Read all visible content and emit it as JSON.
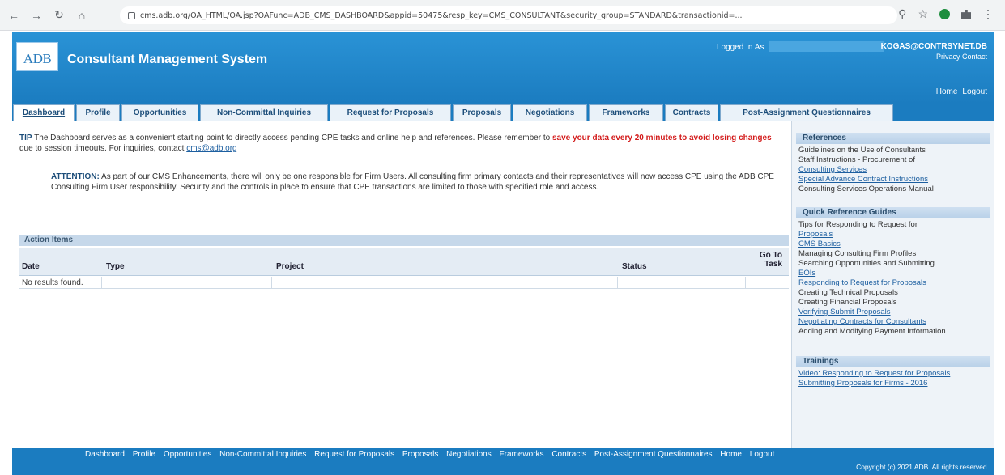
{
  "browser": {
    "url": "cms.adb.org/OA_HTML/OA.jsp?OAFunc=ADB_CMS_DASHBOARD&appid=50475&resp_key=CMS_CONSULTANT&security_group=STANDARD&transactionid=..."
  },
  "header": {
    "logo_text": "ADB",
    "app_title": "Consultant Management System",
    "logged_in_label": "Logged In As",
    "user": "KOGAS@CONTRSYNET.DB",
    "privacy": "Privacy Contact",
    "links": [
      "Home",
      "Logout"
    ]
  },
  "tabs": [
    {
      "label": "Dashboard",
      "active": true
    },
    {
      "label": "Profile",
      "active": false
    },
    {
      "label": "Opportunities",
      "active": false
    },
    {
      "label": "Non-Committal Inquiries",
      "active": false
    },
    {
      "label": "Request for Proposals",
      "active": false
    },
    {
      "label": "Proposals",
      "active": false
    },
    {
      "label": "Negotiations",
      "active": false
    },
    {
      "label": "Frameworks",
      "active": false
    },
    {
      "label": "Contracts",
      "active": false
    },
    {
      "label": "Post-Assignment Questionnaires",
      "active": false
    }
  ],
  "tip": {
    "label": "TIP",
    "text1": "The Dashboard serves as a convenient starting point to directly access pending CPE tasks and online help and references. Please remember to",
    "red": "save your data every 20 minutes to avoid losing changes",
    "text2": "due to session timeouts. For inquiries, contact",
    "link": "cms@adb.org"
  },
  "attention": {
    "label": "ATTENTION:",
    "text": "As part of our CMS Enhancements, there will only be one responsible for Firm Users. All consulting firm primary contacts and their representatives will now access CPE using the ADB CPE Consulting Firm User responsibility. Security and the controls in place to ensure that CPE transactions are limited to those with specified role and access."
  },
  "action_items": {
    "title": "Action Items",
    "columns": [
      "Date",
      "Type",
      "Project",
      "Status",
      "Go To Task"
    ],
    "rows": [
      [
        "No results found."
      ]
    ]
  },
  "sidebar": {
    "sections": [
      {
        "title": "References",
        "items": [
          {
            "text": "Guidelines on the Use of Consultants",
            "link": false
          },
          {
            "text": "Staff Instructions - Procurement of",
            "link": false
          },
          {
            "text": "Consulting Services",
            "link": true
          },
          {
            "text": "Special Advance Contract Instructions",
            "link": true
          },
          {
            "text": "Consulting Services Operations Manual",
            "link": false
          }
        ]
      },
      {
        "title": "Quick Reference Guides",
        "items": [
          {
            "text": "Tips for Responding to Request for",
            "link": false
          },
          {
            "text": "Proposals",
            "link": true
          },
          {
            "text": "CMS Basics",
            "link": true
          },
          {
            "text": "Managing Consulting Firm Profiles",
            "link": false
          },
          {
            "text": "Searching Opportunities and Submitting",
            "link": false
          },
          {
            "text": "EOIs",
            "link": true
          },
          {
            "text": "Responding to Request for Proposals",
            "link": true
          },
          {
            "text": "Creating Technical Proposals",
            "link": false
          },
          {
            "text": "Creating Financial Proposals",
            "link": false
          },
          {
            "text": "Verifying Submit Proposals",
            "link": true
          },
          {
            "text": "Negotiating Contracts for Consultants",
            "link": true
          },
          {
            "text": "Adding and Modifying Payment Information",
            "link": false
          }
        ]
      },
      {
        "title": "Trainings",
        "items": [
          {
            "text": "Video: Responding to Request for Proposals",
            "link": true
          },
          {
            "text": "Submitting Proposals for Firms - 2016",
            "link": true
          }
        ]
      }
    ]
  },
  "footer": {
    "links": [
      "Dashboard",
      "Profile",
      "Opportunities",
      "Non-Committal Inquiries",
      "Request for Proposals",
      "Proposals",
      "Negotiations",
      "Frameworks",
      "Contracts",
      "Post-Assignment Questionnaires",
      "Home",
      "Logout"
    ],
    "copyright": "Copyright (c) 2021 ADB. All rights reserved."
  }
}
